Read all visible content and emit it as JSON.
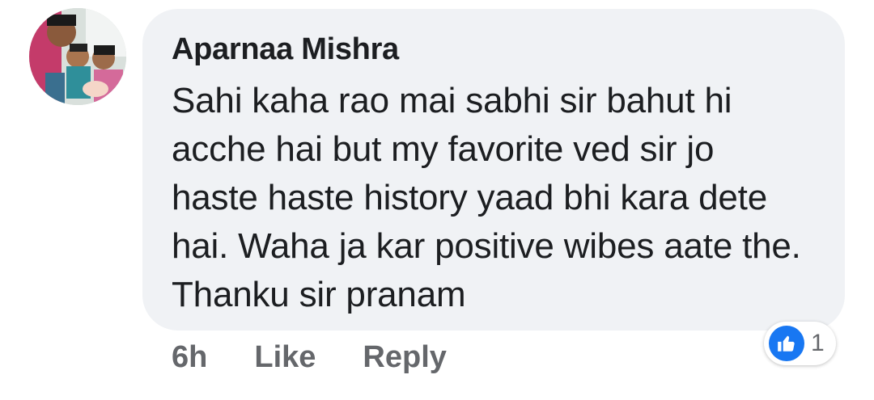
{
  "comment": {
    "author": "Aparnaa Mishra",
    "text": "Sahi kaha rao mai sabhi sir bahut hi acche hai but my favorite ved sir jo haste haste history yaad bhi kara dete hai. Waha ja kar positive wibes aate the. Thanku sir pranam",
    "time": "6h",
    "like_label": "Like",
    "reply_label": "Reply",
    "reaction_icon": "thumbs-up-icon",
    "reaction_count": "1"
  },
  "colors": {
    "bubble": "#f0f2f5",
    "text": "#1c1e21",
    "secondary": "#65676b",
    "like_blue": "#1877f2"
  }
}
